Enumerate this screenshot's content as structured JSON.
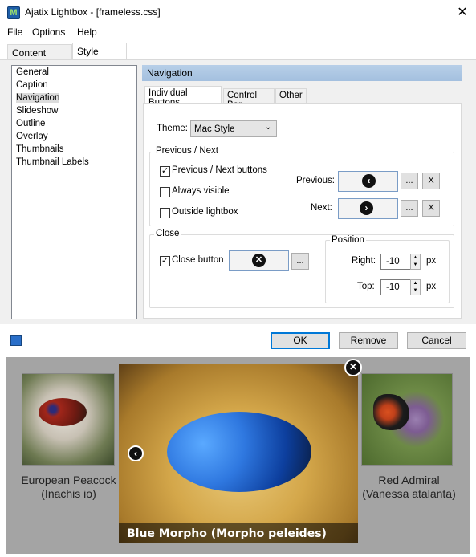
{
  "window": {
    "title": "Ajatix Lightbox - [frameless.css]",
    "close": "✕",
    "icon": "M"
  },
  "menu": [
    "File",
    "Options",
    "Help"
  ],
  "top_tabs": [
    "Content Editor",
    "Style Editor"
  ],
  "sidebar": [
    "General",
    "Caption",
    "Navigation",
    "Slideshow",
    "Outline",
    "Overlay",
    "Thumbnails",
    "Thumbnail Labels"
  ],
  "section_header": "Navigation",
  "sub_tabs": [
    "Individual Buttons",
    "Control Bar",
    "Other"
  ],
  "theme": {
    "label": "Theme:",
    "value": "Mac Style"
  },
  "prevnext": {
    "group_label": "Previous / Next",
    "cb_buttons": "Previous / Next buttons",
    "cb_buttons_checked": true,
    "cb_always": "Always visible",
    "cb_always_checked": false,
    "cb_outside": "Outside lightbox",
    "cb_outside_checked": false,
    "prev_label": "Previous:",
    "next_label": "Next:",
    "browse": "...",
    "clear": "X"
  },
  "close": {
    "group_label": "Close",
    "cb_close": "Close button",
    "cb_close_checked": true,
    "browse": "...",
    "position_label": "Position",
    "right_label": "Right:",
    "right_value": "-10",
    "top_label": "Top:",
    "top_value": "-10",
    "unit": "px"
  },
  "buttons": {
    "ok": "OK",
    "remove": "Remove",
    "cancel": "Cancel"
  },
  "gallery": {
    "left_caption": [
      "European Peacock",
      "(Inachis io)"
    ],
    "right_caption": [
      "Red Admiral",
      "(Vanessa atalanta)"
    ],
    "main_caption": "Blue Morpho (Morpho peleides)"
  },
  "colors": {
    "header": "#a4c0df",
    "gallery_bg": "#a4a4a4",
    "focus_border": "#0078d7"
  }
}
